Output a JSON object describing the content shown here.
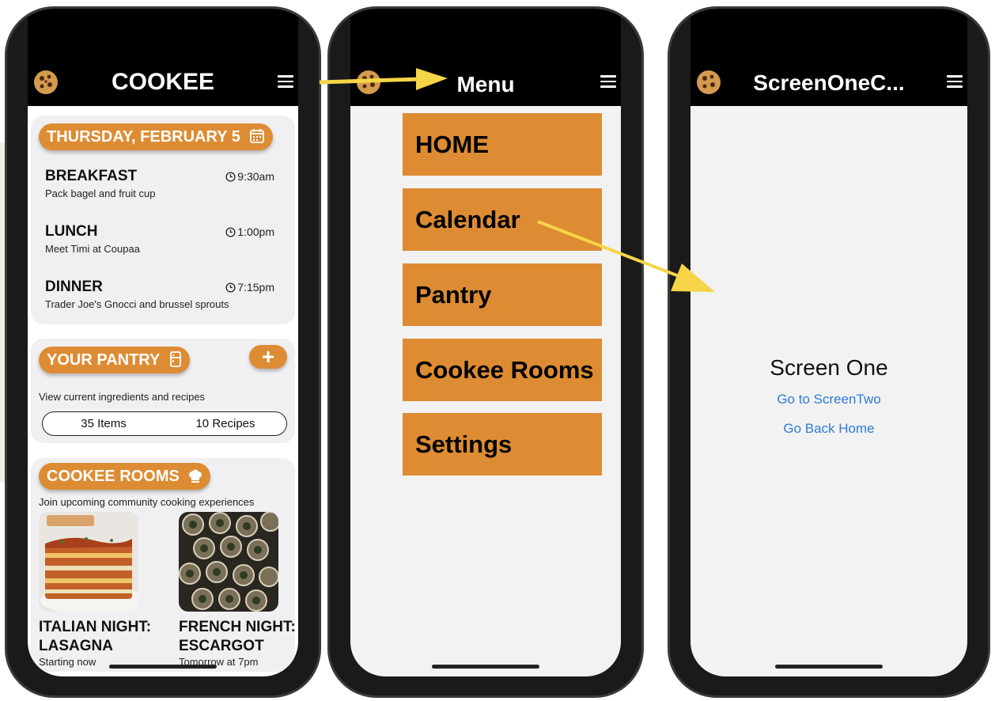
{
  "screen1": {
    "title": "COOKEE",
    "date_label": "THURSDAY, FEBRUARY 5",
    "meals": [
      {
        "title": "BREAKFAST",
        "time": "9:30am",
        "desc": "Pack bagel and fruit cup"
      },
      {
        "title": "LUNCH",
        "time": "1:00pm",
        "desc": "Meet Timi at Coupaa"
      },
      {
        "title": "DINNER",
        "time": "7:15pm",
        "desc": "Trader Joe's Gnocci and brussel sprouts"
      }
    ],
    "pantry": {
      "label": "YOUR PANTRY",
      "add_label": "+",
      "desc": "View current ingredients and recipes",
      "items": "35 Items",
      "recipes": "10 Recipes"
    },
    "rooms": {
      "label": "COOKEE ROOMS",
      "desc": "Join upcoming community cooking experiences",
      "list": [
        {
          "title": "ITALIAN NIGHT: LASAGNA",
          "sub": "Starting now"
        },
        {
          "title": "FRENCH NIGHT: ESCARGOT",
          "sub": "Tomorrow at 7pm"
        }
      ]
    }
  },
  "screen2": {
    "title": "Menu",
    "items": [
      "HOME",
      "Calendar",
      "Pantry",
      "Cookee Rooms",
      "Settings"
    ]
  },
  "screen3": {
    "title": "ScreenOneC...",
    "heading": "Screen One",
    "link1": "Go to ScreenTwo",
    "link2": "Go Back Home"
  },
  "icons": [
    "cookie-icon",
    "hamburger-icon",
    "calendar-icon",
    "clock-icon",
    "fridge-icon",
    "chef-hat-icon",
    "plus-icon",
    "arrow-annotation"
  ],
  "colors": {
    "accent": "#dd8c33",
    "link": "#2f7bd6",
    "annotation": "#f5d547",
    "header": "#000000"
  }
}
